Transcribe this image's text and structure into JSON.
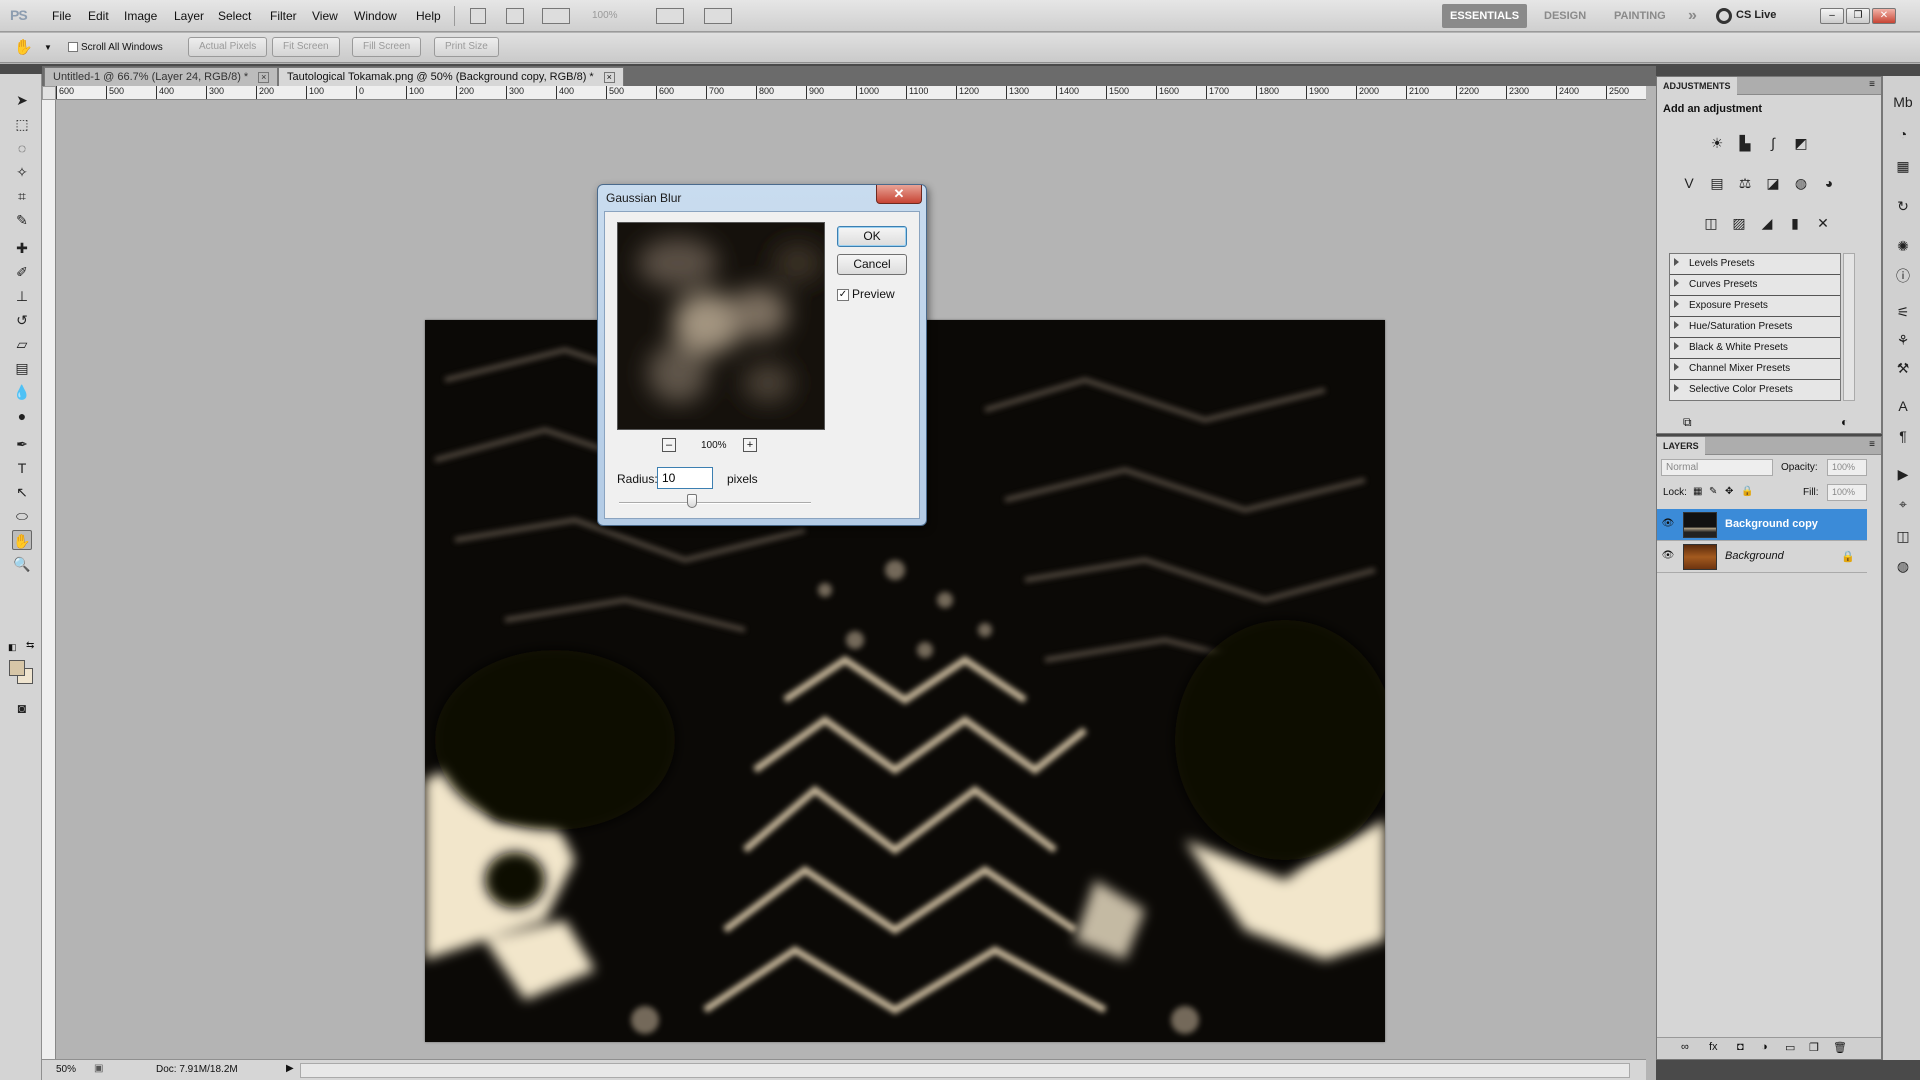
{
  "app": {
    "logo": "PS",
    "menus": [
      "File",
      "Edit",
      "Image",
      "Layer",
      "Select",
      "Filter",
      "View",
      "Window",
      "Help"
    ],
    "zoom_field": "100%",
    "workspaces": [
      "ESSENTIALS",
      "DESIGN",
      "PAINTING"
    ],
    "workspace_more": "»",
    "cs_live": "CS Live",
    "window_controls": [
      "–",
      "❐",
      "✕"
    ]
  },
  "options_bar": {
    "scroll_all_windows": "Scroll All Windows",
    "buttons": [
      "Actual Pixels",
      "Fit Screen",
      "Fill Screen",
      "Print Size"
    ]
  },
  "doc_tabs": [
    {
      "label": "Untitled-1 @ 66.7% (Layer 24, RGB/8) *"
    },
    {
      "label": "Tautological Tokamak.png @ 50% (Background copy, RGB/8) *"
    }
  ],
  "ruler_h": [
    "600",
    "500",
    "400",
    "300",
    "200",
    "100",
    "0",
    "100",
    "200",
    "300",
    "400",
    "500",
    "600",
    "700",
    "800",
    "900",
    "1000",
    "1100",
    "1200",
    "1300",
    "1400",
    "1500",
    "1600",
    "1700",
    "1800",
    "1900",
    "2000",
    "2100",
    "2200",
    "2300",
    "2400",
    "2500"
  ],
  "status": {
    "zoom": "50%",
    "doc": "Doc: 7.91M/18.2M"
  },
  "dialog": {
    "title": "Gaussian Blur",
    "close": "✕",
    "ok": "OK",
    "cancel": "Cancel",
    "preview_label": "Preview",
    "preview_checked": true,
    "zoom_out": "–",
    "zoom_in": "+",
    "zoom_pct": "100%",
    "radius_label": "Radius:",
    "radius_value": "10",
    "radius_unit": "pixels",
    "slider_level": 0.38
  },
  "adjustments": {
    "tab": "ADJUSTMENTS",
    "subtitle": "Add an adjustment",
    "presets": [
      "Levels Presets",
      "Curves Presets",
      "Exposure Presets",
      "Hue/Saturation Presets",
      "Black & White Presets",
      "Channel Mixer Presets",
      "Selective Color Presets"
    ]
  },
  "layers": {
    "tab": "LAYERS",
    "blend_mode": "Normal",
    "opacity_label": "Opacity:",
    "opacity": "100%",
    "lock_label": "Lock:",
    "fill_label": "Fill:",
    "fill": "100%",
    "items": [
      {
        "name": "Background copy",
        "selected": true
      },
      {
        "name": "Background",
        "selected": false,
        "locked": true
      }
    ]
  },
  "colors": {
    "foreground": "#d7c6a7",
    "background": "#efe4cf",
    "selection": "#3b8bd8",
    "dialog_close": "#c74434"
  }
}
